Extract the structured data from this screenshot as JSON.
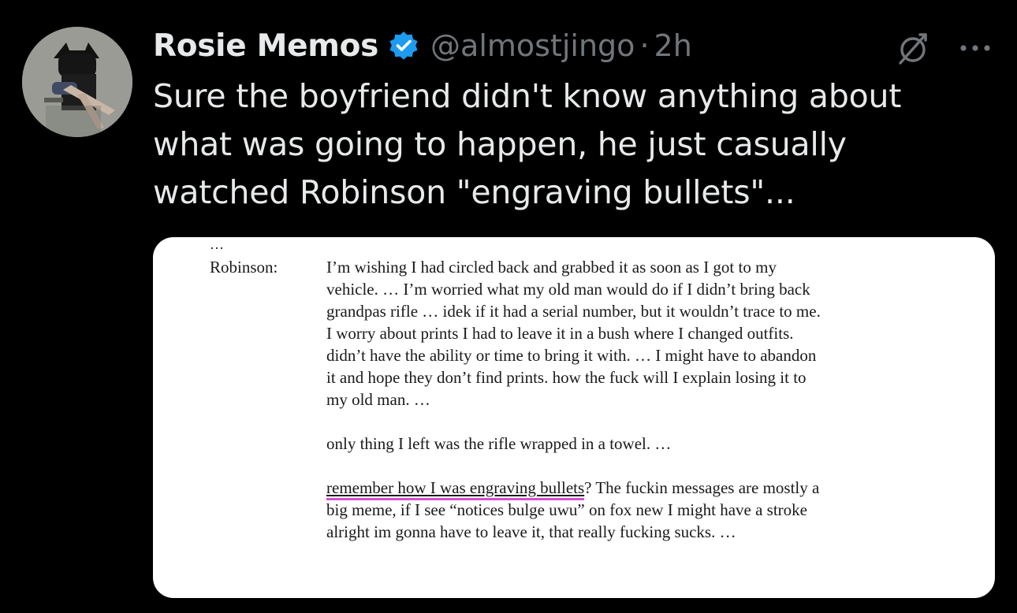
{
  "tweet": {
    "author_name": "Rosie Memos",
    "handle": "@almostjingo",
    "separator": "·",
    "time": "2h",
    "text": "Sure the boyfriend didn't know anything about\nwhat was going to happen, he just casually\nwatched Robinson \"engraving bullets\"...",
    "icons": {
      "verified": "verified-badge-icon",
      "grok": "grok-icon",
      "more": "more-options-icon"
    },
    "colors": {
      "background": "#000000",
      "text": "#e7e9ea",
      "muted": "#71767b",
      "verified": "#1d9bf0",
      "highlight_underline": "#d84fd1"
    }
  },
  "document": {
    "ellipsis": "…",
    "speaker": "Robinson:",
    "paragraph1": [
      "I’m wishing I had circled back and grabbed it as soon as I got to my",
      "vehicle. … I’m worried what my old man would do if I didn’t bring back",
      "grandpas rifle … idek if it had a serial number, but it wouldn’t trace to me.",
      "I worry about prints I had to leave it in a bush where I changed outfits.",
      "didn’t have the ability or time to bring it with. … I might have to abandon",
      "it and hope they don’t find prints. how the fuck will I explain losing it to",
      "my old man. …"
    ],
    "paragraph2": "only thing I left was the rifle wrapped in a towel. …",
    "paragraph3_highlight": "remember how I was engraving bullets",
    "paragraph3_line1_rest": "? The fuckin messages are mostly a",
    "paragraph3_line2": "big meme, if I see “notices bulge uwu” on fox new I might have a stroke",
    "paragraph3_line3": "alright im gonna have to leave it, that really fucking sucks. …"
  }
}
